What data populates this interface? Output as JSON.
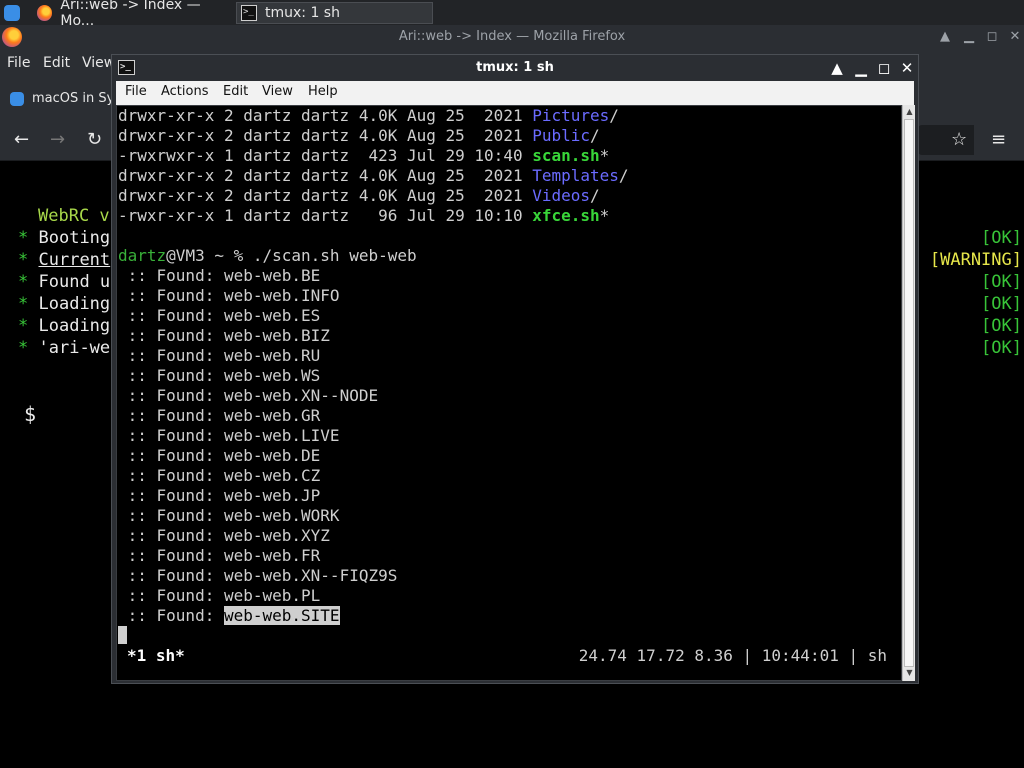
{
  "taskbar": {
    "firefox_task": "Ari::web -> Index — Mo...",
    "tmux_task": "tmux: 1 sh"
  },
  "firefox": {
    "title": "Ari::web -> Index — Mozilla Firefox",
    "menu": [
      "File",
      "Edit",
      "View"
    ],
    "bookmark": "macOS in Sy",
    "console_title": "WebRC v",
    "boot_lines": [
      {
        "star": "*",
        "text": "Booting",
        "status": "[OK]"
      },
      {
        "star": "*",
        "text": "Current",
        "status": "[WARNING]"
      },
      {
        "star": "*",
        "text": "Found u",
        "status": "[OK]"
      },
      {
        "star": "*",
        "text": "Loading",
        "status": "[OK]"
      },
      {
        "star": "*",
        "text": "Loading",
        "status": "[OK]"
      },
      {
        "star": "*",
        "text": "'ari-we",
        "status": "[OK]"
      }
    ],
    "prompt": "$",
    "colors": {
      "ok": "#38c438",
      "warning": "#e6e64a"
    }
  },
  "terminal": {
    "title": "tmux: 1 sh",
    "menu": [
      "File",
      "Actions",
      "Edit",
      "View",
      "Help"
    ],
    "listing": [
      {
        "perms": "drwxr-xr-x 2 dartz dartz 4.0K Aug 25  2021 ",
        "name": "Pictures",
        "suffix": "/",
        "type": "dir"
      },
      {
        "perms": "drwxr-xr-x 2 dartz dartz 4.0K Aug 25  2021 ",
        "name": "Public",
        "suffix": "/",
        "type": "dir"
      },
      {
        "perms": "-rwxrwxr-x 1 dartz dartz  423 Jul 29 10:40 ",
        "name": "scan.sh",
        "suffix": "*",
        "type": "exe"
      },
      {
        "perms": "drwxr-xr-x 2 dartz dartz 4.0K Aug 25  2021 ",
        "name": "Templates",
        "suffix": "/",
        "type": "dir"
      },
      {
        "perms": "drwxr-xr-x 2 dartz dartz 4.0K Aug 25  2021 ",
        "name": "Videos",
        "suffix": "/",
        "type": "dir"
      },
      {
        "perms": "-rwxr-xr-x 1 dartz dartz   96 Jul 29 10:10 ",
        "name": "xfce.sh",
        "suffix": "*",
        "type": "exe"
      }
    ],
    "prompt_user": "dartz",
    "prompt_rest": "@VM3 ~ % ./scan.sh web-web",
    "found_prefix": " :: Found: ",
    "found": [
      "web-web.BE",
      "web-web.INFO",
      "web-web.ES",
      "web-web.BIZ",
      "web-web.RU",
      "web-web.WS",
      "web-web.XN--NODE",
      "web-web.GR",
      "web-web.LIVE",
      "web-web.DE",
      "web-web.CZ",
      "web-web.JP",
      "web-web.WORK",
      "web-web.XYZ",
      "web-web.FR",
      "web-web.XN--FIQZ9S",
      "web-web.PL",
      "web-web.SITE"
    ],
    "status_left": "*1 sh*",
    "status_right": "24.74 17.72 8.36 | 10:44:01 | sh",
    "colors": {
      "dir": "#6b6bff",
      "exe": "#39d639",
      "user": "#39b039"
    }
  }
}
